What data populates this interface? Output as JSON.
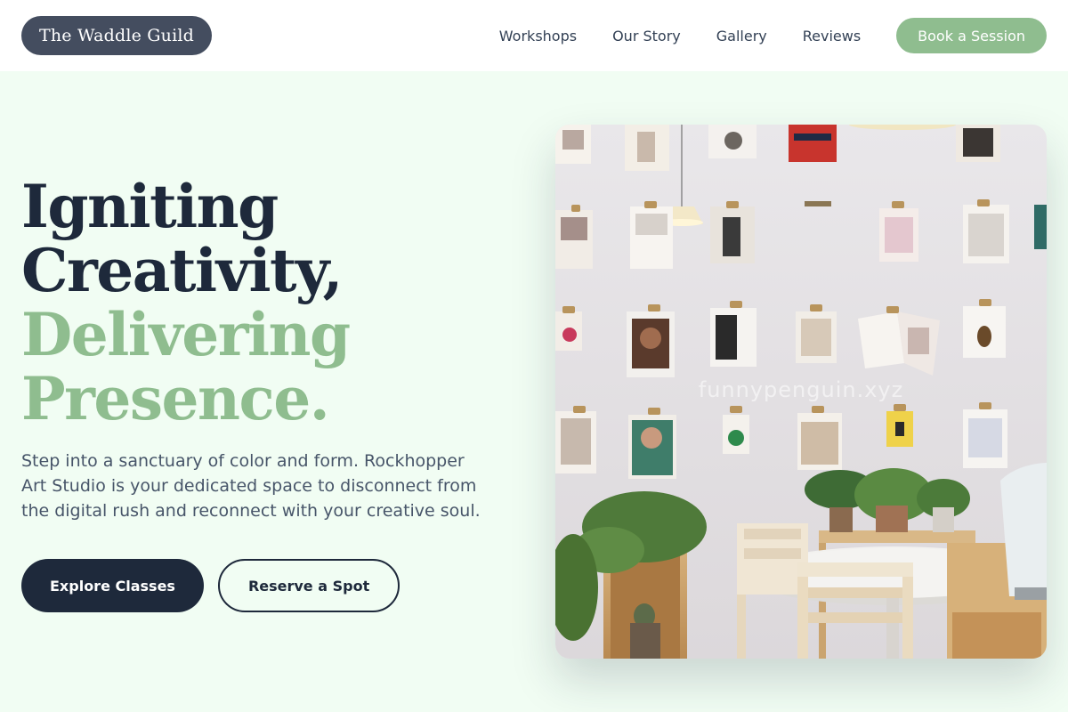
{
  "header": {
    "logo": "The Waddle Guild",
    "nav": [
      "Workshops",
      "Our Story",
      "Gallery",
      "Reviews"
    ],
    "cta": "Book a Session"
  },
  "hero": {
    "headline_dark": [
      "Igniting",
      "Creativity,"
    ],
    "headline_green": [
      "Delivering",
      "Presence."
    ],
    "lead": "Step into a sanctuary of color and form. Rockhopper Art Studio is your dedicated space to disconnect from the digital rush and reconnect with your creative soul.",
    "primary_button": "Explore Classes",
    "secondary_button": "Reserve a Spot",
    "watermark": "funnypenguin.xyz"
  },
  "colors": {
    "background": "#f1fdf3",
    "accent_green": "#8fbd8f",
    "navy": "#1e293b",
    "logo_bg": "#444d5f"
  }
}
